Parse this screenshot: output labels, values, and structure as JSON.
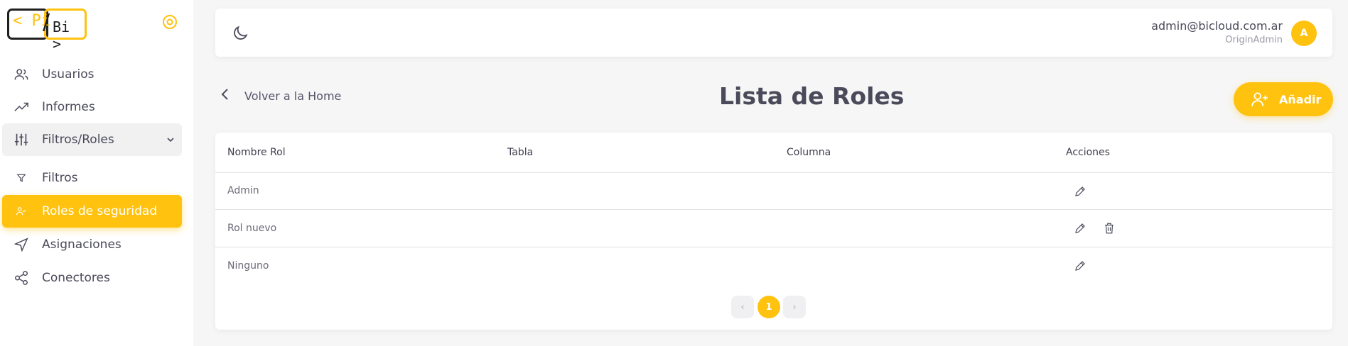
{
  "brand": {
    "logo_left": "< Pi",
    "logo_right": "Bi >",
    "logo_slash": "/"
  },
  "sidebar": {
    "items": [
      {
        "label": "Usuarios",
        "icon": "users-icon"
      },
      {
        "label": "Informes",
        "icon": "trending-up-icon"
      },
      {
        "label": "Filtros/Roles",
        "icon": "sliders-icon",
        "expanded": true
      },
      {
        "label": "Filtros",
        "icon": "filter-icon"
      },
      {
        "label": "Roles de seguridad",
        "icon": "user-check-icon",
        "active": true
      },
      {
        "label": "Asignaciones",
        "icon": "send-icon"
      },
      {
        "label": "Conectores",
        "icon": "share-icon"
      }
    ]
  },
  "header": {
    "email": "admin@bicloud.com.ar",
    "role": "OriginAdmin",
    "avatar_initial": "A"
  },
  "page": {
    "back_label": "Volver a la Home",
    "title": "Lista de Roles",
    "add_label": "Añadir"
  },
  "table": {
    "columns": [
      "Nombre Rol",
      "Tabla",
      "Columna",
      "Acciones"
    ],
    "rows": [
      {
        "name": "Admin",
        "tabla": "",
        "columna": "",
        "actions": [
          "edit"
        ]
      },
      {
        "name": "Rol nuevo",
        "tabla": "",
        "columna": "",
        "actions": [
          "edit",
          "delete"
        ]
      },
      {
        "name": "Ninguno",
        "tabla": "",
        "columna": "",
        "actions": [
          "edit"
        ]
      }
    ]
  },
  "pagination": {
    "prev": "‹",
    "current": "1",
    "next": "›"
  },
  "colors": {
    "accent": "#ffc20e",
    "text": "#4a4a5a",
    "background": "#f6f6f6"
  }
}
